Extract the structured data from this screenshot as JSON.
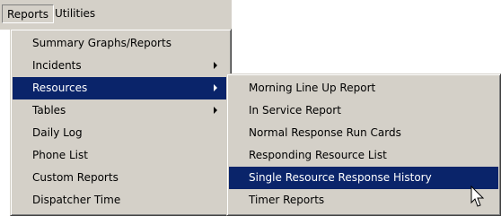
{
  "menubar": {
    "reports_label": "Reports",
    "utilities_label": "Utilities"
  },
  "reports_menu": {
    "items": [
      {
        "label": "Summary Graphs/Reports"
      },
      {
        "label": "Incidents"
      },
      {
        "label": "Resources"
      },
      {
        "label": "Tables"
      },
      {
        "label": "Daily Log"
      },
      {
        "label": "Phone List"
      },
      {
        "label": "Custom Reports"
      },
      {
        "label": "Dispatcher Time"
      }
    ]
  },
  "resources_submenu": {
    "items": [
      {
        "label": "Morning Line Up Report"
      },
      {
        "label": "In Service Report"
      },
      {
        "label": "Normal Response Run Cards"
      },
      {
        "label": "Responding Resource List"
      },
      {
        "label": "Single Resource Response History"
      },
      {
        "label": "Timer Reports"
      }
    ]
  },
  "colors": {
    "menu_bg": "#d4d0c8",
    "highlight": "#0a246a"
  }
}
